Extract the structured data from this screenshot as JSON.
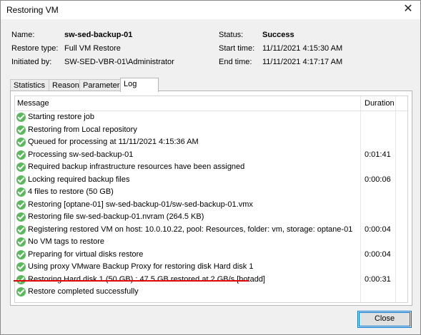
{
  "window": {
    "title": "Restoring VM",
    "close_label": "✕"
  },
  "info": {
    "name_label": "Name:",
    "name_value": "sw-sed-backup-01",
    "restore_type_label": "Restore type:",
    "restore_type_value": "Full VM Restore",
    "initiated_by_label": "Initiated by:",
    "initiated_by_value": "SW-SED-VBR-01\\Administrator",
    "status_label": "Status:",
    "status_value": "Success",
    "start_time_label": "Start time:",
    "start_time_value": "11/11/2021 4:15:30 AM",
    "end_time_label": "End time:",
    "end_time_value": "11/11/2021 4:17:17 AM"
  },
  "tabs": [
    "Statistics",
    "Reason",
    "Parameters",
    "Log"
  ],
  "active_tab": "Log",
  "log": {
    "columns": {
      "message": "Message",
      "duration": "Duration"
    },
    "rows": [
      {
        "message": "Starting restore job",
        "duration": ""
      },
      {
        "message": "Restoring from Local repository",
        "duration": ""
      },
      {
        "message": "Queued for processing at 11/11/2021 4:15:36 AM",
        "duration": ""
      },
      {
        "message": "Processing sw-sed-backup-01",
        "duration": "0:01:41"
      },
      {
        "message": "Required backup infrastructure resources have been assigned",
        "duration": ""
      },
      {
        "message": "Locking required backup files",
        "duration": "0:00:06"
      },
      {
        "message": "4 files to restore (50 GB)",
        "duration": ""
      },
      {
        "message": "Restoring [optane-01] sw-sed-backup-01/sw-sed-backup-01.vmx",
        "duration": ""
      },
      {
        "message": "Restoring file sw-sed-backup-01.nvram (264.5 KB)",
        "duration": ""
      },
      {
        "message": "Registering restored VM on host: 10.0.10.22, pool: Resources, folder: vm, storage: optane-01",
        "duration": "0:00:04"
      },
      {
        "message": "No VM tags to restore",
        "duration": ""
      },
      {
        "message": "Preparing for virtual disks restore",
        "duration": "0:00:04"
      },
      {
        "message": "Using proxy VMware Backup Proxy for restoring disk Hard disk 1",
        "duration": ""
      },
      {
        "message": "Restoring Hard disk 1 (50 GB) : 47.5 GB restored at 2 GB/s  [hotadd]",
        "duration": "0:00:31"
      },
      {
        "message": "Restore completed successfully",
        "duration": ""
      }
    ]
  },
  "status_icon": "success-check-icon",
  "status_color": "#5cb85c",
  "highlight_color": "#e00000",
  "buttons": {
    "close": "Close"
  }
}
